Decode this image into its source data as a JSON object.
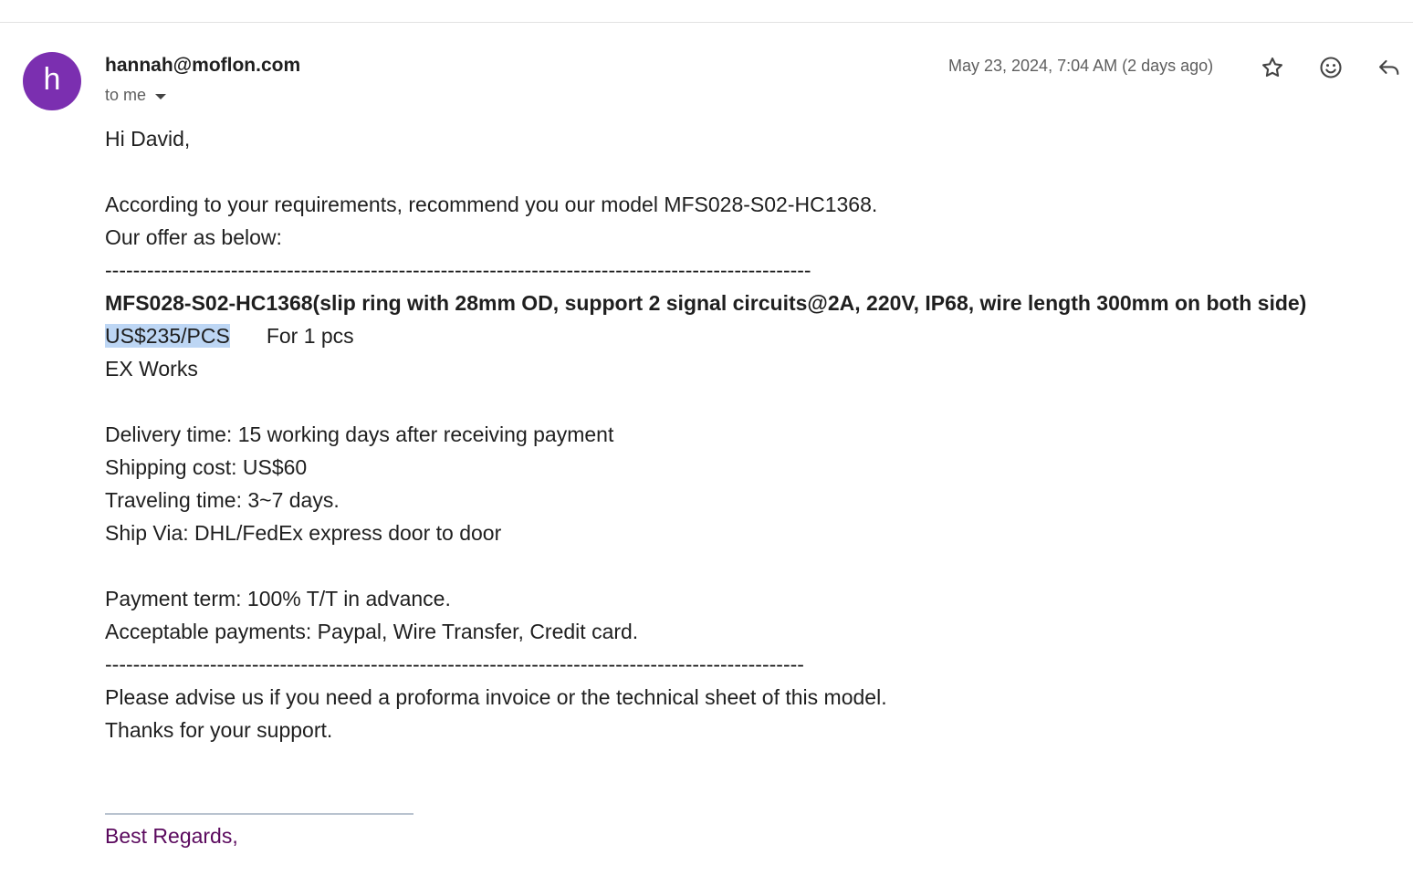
{
  "header": {
    "avatar_letter": "h",
    "avatar_color": "#7b2fb0",
    "sender": "hannah@moflon.com",
    "recipient": "to me",
    "date": "May 23, 2024, 7:04 AM (2 days ago)",
    "actions": [
      "star-icon",
      "emoji-reaction-icon",
      "reply-icon"
    ]
  },
  "body": {
    "greeting": "Hi David,",
    "intro": "According to your requirements, recommend you our model MFS028-S02-HC1368.",
    "offer_intro": "Our offer as below:",
    "divider_top": "-----------------------------------------------------------------------------------------------------",
    "product": "MFS028-S02-HC1368(slip ring with 28mm OD, support 2 signal circuits@2A, 220V, IP68, wire length 300mm on both side)",
    "price": "US$235/PCS",
    "quantity": "For 1  pcs",
    "incoterm": "EX Works",
    "delivery": "Delivery time:  15 working days after receiving payment",
    "shipping": "Shipping cost: US$60",
    "traveling": "Traveling time: 3~7 days.",
    "ship_via": "Ship Via:  DHL/FedEx express door to door",
    "payment_term": "Payment term: 100% T/T in advance.",
    "payments": "Acceptable payments:  Paypal, Wire Transfer, Credit card.",
    "divider_bottom": "----------------------------------------------------------------------------------------------------",
    "advise": "Please advise us if you need a proforma invoice or the technical sheet of this model.",
    "thanks": "Thanks for your support."
  },
  "signature": {
    "closing": "Best Regards,",
    "color": "#5b0a5e"
  }
}
